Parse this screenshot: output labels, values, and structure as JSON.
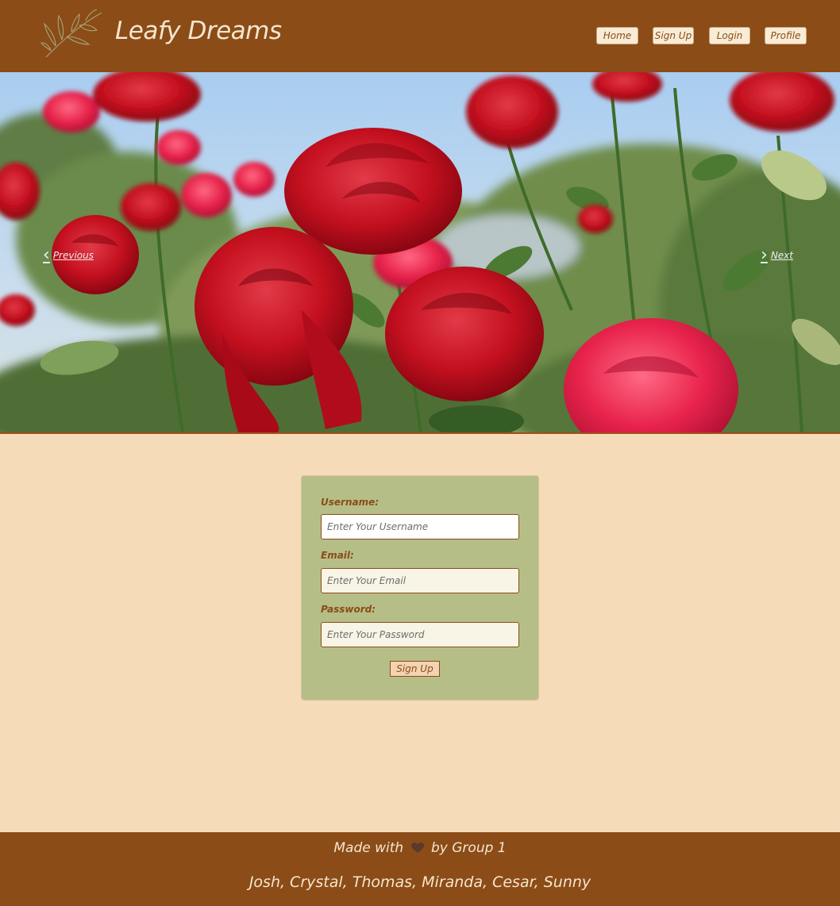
{
  "brand": {
    "title": "Leafy Dreams",
    "logo_icon": "leaf-branch-icon"
  },
  "nav": {
    "items": [
      {
        "label": "Home"
      },
      {
        "label": "Sign Up"
      },
      {
        "label": "Login"
      },
      {
        "label": "Profile"
      }
    ]
  },
  "carousel": {
    "prev_label": "Previous",
    "next_label": "Next",
    "prev_icon": "chevron-left-icon",
    "next_icon": "chevron-right-icon"
  },
  "form": {
    "username_label": "Username:",
    "username_placeholder": "Enter Your Username",
    "email_label": "Email:",
    "email_placeholder": "Enter Your Email",
    "password_label": "Password:",
    "password_placeholder": "Enter Your Password",
    "submit_label": "Sign Up"
  },
  "footer": {
    "made_with_prefix": "Made with",
    "heart_icon": "heart-icon",
    "made_with_suffix": "by Group 1",
    "members": "Josh, Crystal, Thomas, Miranda, Cesar, Sunny"
  },
  "colors": {
    "header_bg": "#8b4c17",
    "page_bg": "#f6dbb9",
    "card_bg": "#b6be88",
    "accent_text": "#8b4c17",
    "light_text": "#f5e6cf"
  }
}
